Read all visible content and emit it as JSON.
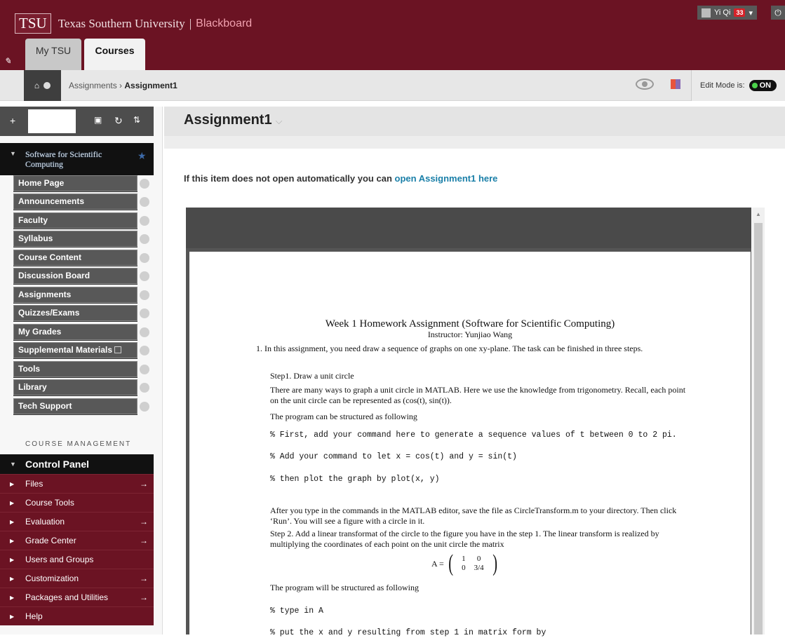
{
  "header": {
    "logo": "TSU",
    "university": "Texas Southern University",
    "separator": "|",
    "product": "Blackboard",
    "tabs": [
      "My TSU",
      "Courses"
    ],
    "user": {
      "name": "Yi Qi",
      "notifications": "33"
    }
  },
  "breadcrumb": {
    "parent": "Assignments",
    "separator": "›",
    "current": "Assignment1"
  },
  "edit_mode": {
    "label": "Edit Mode is:",
    "state": "ON"
  },
  "course": {
    "name": "Software for Scientific Computing"
  },
  "menu": [
    "Home Page",
    "Announcements",
    "Faculty",
    "Syllabus",
    "Course Content",
    "Discussion Board",
    "Assignments",
    "Quizzes/Exams",
    "My Grades",
    "Supplemental Materials",
    "Tools",
    "Library",
    "Tech Support"
  ],
  "course_management": {
    "heading": "COURSE MANAGEMENT",
    "control_panel": "Control Panel",
    "items": [
      "Files",
      "Course Tools",
      "Evaluation",
      "Grade Center",
      "Users and Groups",
      "Customization",
      "Packages and Utilities",
      "Help"
    ]
  },
  "main": {
    "title": "Assignment1",
    "open_text": "If this item does not open automatically you can",
    "open_link": "open Assignment1 here"
  },
  "document": {
    "title": "Week 1 Homework Assignment (Software for Scientific Computing)",
    "instructor": "Instructor: Yunjiao Wang",
    "lines": [
      "1. In this assignment, you need draw a sequence of graphs on one xy-plane. The task can be finished in three steps.",
      "Step1. Draw a unit circle",
      "There are many ways to graph a unit circle in MATLAB. Here we use the knowledge from trigonometry. Recall, each point on the unit circle can be represented as (cos(t), sin(t)).",
      "The program can be structured as following",
      "% First, add your command here to generate a sequence values of t between 0 to 2 pi.",
      "% Add your command to let x = cos(t) and y = sin(t)",
      "% then plot the graph by plot(x, y)",
      "After you type in the commands in the MATLAB editor, save the file as CircleTransform.m to your directory. Then click ‘Run’. You will see a figure with a circle in it.",
      "Step 2. Add a linear transformat of the circle to the figure you have in the step 1. The linear transform is realized by multiplying the coordinates of each point on the unit circle the matrix",
      "The program will be structured as following",
      "% type in A",
      "% put the x and y resulting from step 1 in matrix form by"
    ],
    "matrix": {
      "lhs": "A =",
      "rows": [
        [
          "1",
          "0"
        ],
        [
          "0",
          "3/4"
        ]
      ]
    }
  }
}
